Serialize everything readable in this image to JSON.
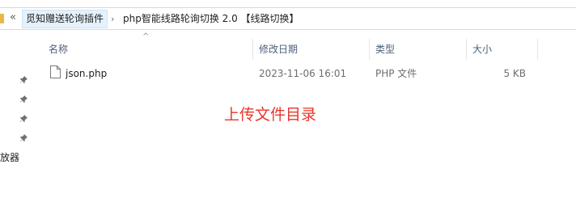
{
  "address_bar": {
    "overflow_symbol": "«",
    "crumbs": [
      "觅知赠送轮询插件",
      "php智能线路轮询切换 2.0 【线路切换】"
    ],
    "separator_symbol": "›"
  },
  "nav": {
    "partial_label": "放器",
    "pin_icons": [
      "pin-icon",
      "pin-icon",
      "pin-icon",
      "pin-icon"
    ]
  },
  "columns": {
    "name": "名称",
    "modified": "修改日期",
    "type": "类型",
    "size": "大小"
  },
  "files": [
    {
      "name": "json.php",
      "modified": "2023-11-06 16:01",
      "type": "PHP 文件",
      "size": "5 KB",
      "icon": "document-icon"
    }
  ],
  "annotation": {
    "text": "上传文件目录",
    "color": "#e8352b"
  },
  "colors": {
    "header_text": "#4c607a",
    "selection_bg": "#e5f1fb",
    "folder": "#e8b84a"
  }
}
